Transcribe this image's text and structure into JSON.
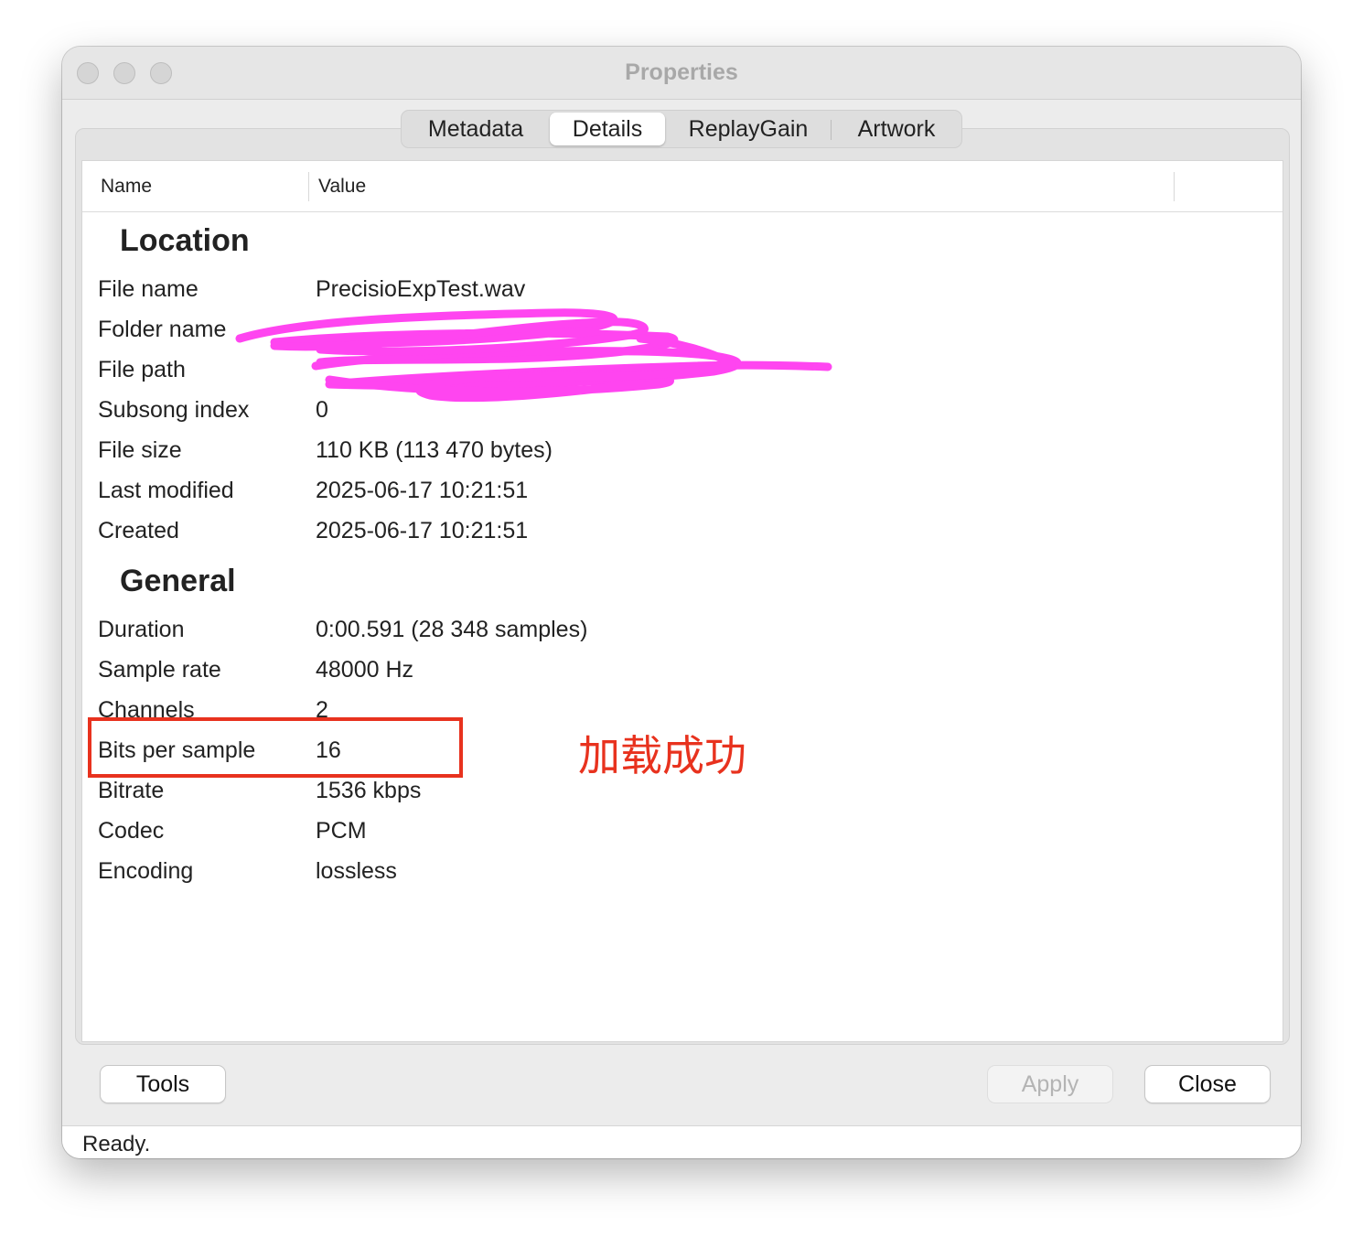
{
  "window": {
    "title": "Properties"
  },
  "tabs": [
    {
      "label": "Metadata",
      "active": false
    },
    {
      "label": "Details",
      "active": true
    },
    {
      "label": "ReplayGain",
      "active": false
    },
    {
      "label": "Artwork",
      "active": false
    }
  ],
  "table": {
    "columns": [
      "Name",
      "Value"
    ],
    "sections": [
      {
        "title": "Location",
        "rows": [
          {
            "name": "File name",
            "value": "PrecisioExpTest.wav"
          },
          {
            "name": "Folder name",
            "value": ""
          },
          {
            "name": "File path",
            "value": ""
          },
          {
            "name": "Subsong index",
            "value": "0"
          },
          {
            "name": "File size",
            "value": "110 KB (113 470 bytes)"
          },
          {
            "name": "Last modified",
            "value": "2025-06-17 10:21:51"
          },
          {
            "name": "Created",
            "value": "2025-06-17 10:21:51"
          }
        ]
      },
      {
        "title": "General",
        "rows": [
          {
            "name": "Duration",
            "value": "0:00.591 (28 348 samples)"
          },
          {
            "name": "Sample rate",
            "value": "48000 Hz"
          },
          {
            "name": "Channels",
            "value": "2"
          },
          {
            "name": "Bits per sample",
            "value": "16"
          },
          {
            "name": "Bitrate",
            "value": "1536 kbps"
          },
          {
            "name": "Codec",
            "value": "PCM"
          },
          {
            "name": "Encoding",
            "value": "lossless"
          }
        ]
      }
    ]
  },
  "buttons": {
    "tools": "Tools",
    "apply": "Apply",
    "close": "Close"
  },
  "status": "Ready.",
  "annotation": {
    "text": "加载成功",
    "color": "#e8321e"
  },
  "redaction_color": "#ff3cf0"
}
